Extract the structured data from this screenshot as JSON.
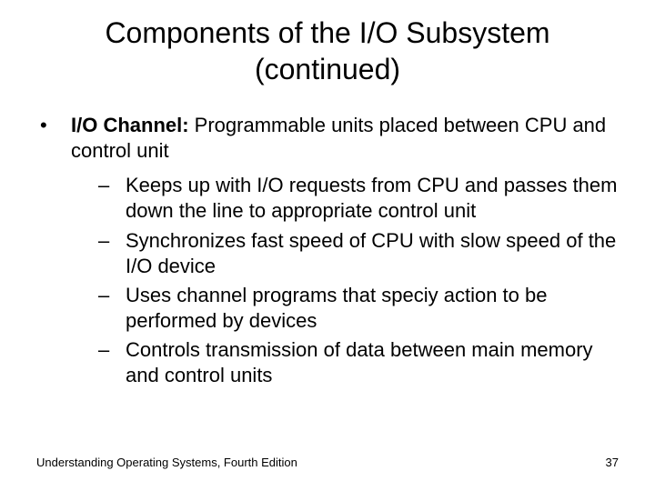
{
  "title_line1": "Components of the I/O Subsystem",
  "title_line2": "(continued)",
  "main": {
    "term": "I/O Channel:",
    "definition": " Programmable units placed between CPU and control unit",
    "subitems": [
      "Keeps up with I/O requests from CPU and passes them down the line to appropriate control unit",
      "Synchronizes fast speed of CPU with slow speed of the I/O device",
      "Uses channel programs that speciy action to be performed by devices",
      "Controls transmission of data between main memory and control units"
    ]
  },
  "footer": {
    "left": "Understanding Operating Systems, Fourth Edition",
    "right": "37"
  },
  "glyphs": {
    "bullet": "•",
    "dash": "–"
  }
}
